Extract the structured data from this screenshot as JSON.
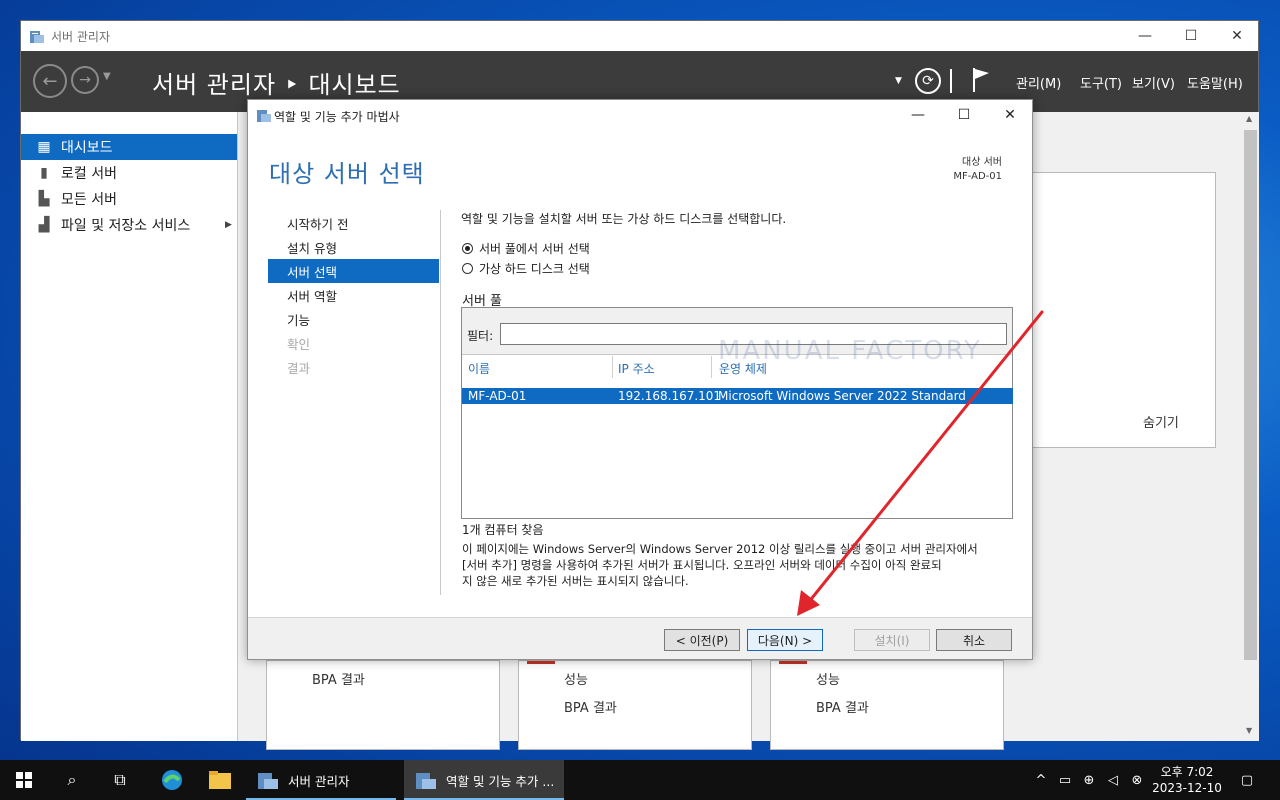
{
  "desktop": {
    "accent_color": "#0a5cc4"
  },
  "server_manager": {
    "window_title": "서버 관리자",
    "breadcrumb": "서버 관리자 ‣ 대시보드",
    "menus": [
      "관리(M)",
      "도구(T)",
      "보기(V)",
      "도움말(H)"
    ],
    "sidebar": [
      {
        "label": "대시보드",
        "icon": "dashboard-icon",
        "active": true
      },
      {
        "label": "로컬 서버",
        "icon": "server-icon",
        "active": false
      },
      {
        "label": "모든 서버",
        "icon": "servers-icon",
        "active": false
      },
      {
        "label": "파일 및 저장소 서비스",
        "icon": "storage-icon",
        "active": false
      }
    ],
    "hide_label": "숨기기",
    "tiles": [
      {
        "items": [
          "BPA 결과"
        ]
      },
      {
        "items": [
          "성능",
          "BPA 결과"
        ]
      },
      {
        "items": [
          "성능",
          "BPA 결과"
        ]
      }
    ]
  },
  "wizard": {
    "title": "역할 및 기능 추가 마법사",
    "heading": "대상 서버 선택",
    "dest_label": "대상 서버",
    "dest_value": "MF-AD-01",
    "steps": [
      {
        "label": "시작하기 전",
        "state": "normal"
      },
      {
        "label": "설치 유형",
        "state": "normal"
      },
      {
        "label": "서버 선택",
        "state": "active"
      },
      {
        "label": "서버 역할",
        "state": "normal"
      },
      {
        "label": "기능",
        "state": "normal"
      },
      {
        "label": "확인",
        "state": "disabled"
      },
      {
        "label": "결과",
        "state": "disabled"
      }
    ],
    "instruction": "역할 및 기능을 설치할 서버 또는 가상 하드 디스크를 선택합니다.",
    "radio_pool": "서버 풀에서 서버 선택",
    "radio_vhd": "가상 하드 디스크 선택",
    "pool_title": "서버 풀",
    "filter_label": "필터:",
    "filter_value": "",
    "columns": [
      "이름",
      "IP 주소",
      "운영 체제"
    ],
    "rows": [
      {
        "name": "MF-AD-01",
        "ip": "192.168.167.101",
        "os": "Microsoft Windows Server 2022 Standard"
      }
    ],
    "watermark": "MANUAL FACTORY",
    "found_count": "1개 컴퓨터 찾음",
    "note": [
      "이 페이지에는 Windows Server의 Windows Server 2012 이상 릴리스를 실행 중이고 서버 관리자에서",
      "[서버 추가] 명령을 사용하여 추가된 서버가 표시됩니다. 오프라인 서버와 데이터 수집이 아직 완료되",
      "지 않은 새로 추가된 서버는 표시되지 않습니다."
    ],
    "buttons": {
      "prev": "< 이전(P)",
      "next": "다음(N) >",
      "install": "설치(I)",
      "cancel": "취소"
    }
  },
  "taskbar": {
    "apps": [
      {
        "label": "서버 관리자"
      },
      {
        "label": "역할 및 기능 추가 ..."
      }
    ],
    "clock_time": "오후 7:02",
    "clock_date": "2023-12-10"
  }
}
